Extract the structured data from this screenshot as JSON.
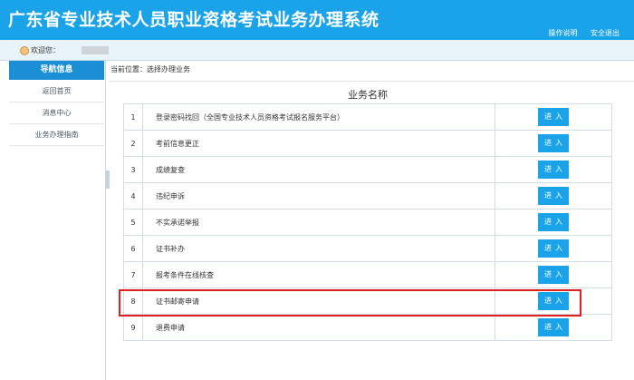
{
  "header": {
    "title": "广东省专业技术人员职业资格考试业务办理系统",
    "links": [
      "操作说明",
      "安全退出"
    ]
  },
  "welcome": {
    "label": "欢迎您："
  },
  "sidebar": {
    "title": "导航信息",
    "items": [
      {
        "label": "返回首页"
      },
      {
        "label": "消息中心"
      },
      {
        "label": "业务办理指南"
      }
    ]
  },
  "breadcrumb": "当前位置：选择办理业务",
  "table": {
    "caption": "业务名称",
    "button_label": "进入",
    "rows": [
      {
        "no": "1",
        "name": "登录密码找回（全国专业技术人员资格考试报名服务平台）"
      },
      {
        "no": "2",
        "name": "考前信息更正"
      },
      {
        "no": "3",
        "name": "成绩复查"
      },
      {
        "no": "4",
        "name": "违纪申诉"
      },
      {
        "no": "5",
        "name": "不实承诺举报"
      },
      {
        "no": "6",
        "name": "证书补办"
      },
      {
        "no": "7",
        "name": "报考条件在线核查"
      },
      {
        "no": "8",
        "name": "证书邮寄申请"
      },
      {
        "no": "9",
        "name": "退费申请"
      }
    ]
  },
  "colors": {
    "header_bg": "#1aa3e8",
    "nav_header_bg": "#1b8fd6",
    "button_bg": "#1aa3e8",
    "highlight_border": "#e02020"
  }
}
